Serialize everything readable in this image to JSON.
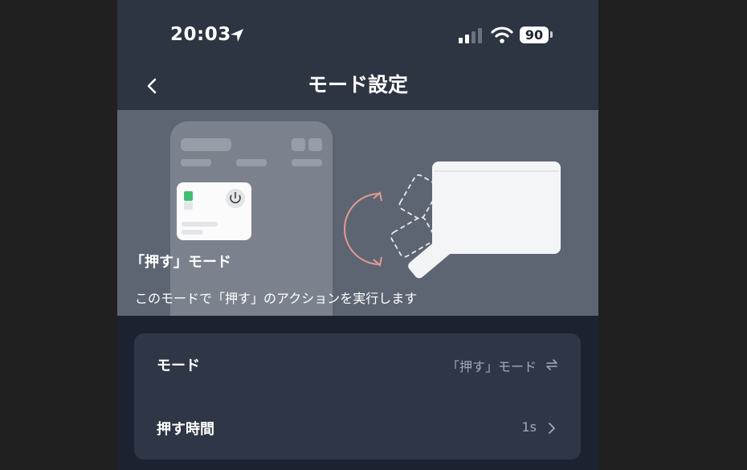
{
  "status_bar": {
    "time": "20:03",
    "battery": "90",
    "icons": [
      "location-arrow-icon",
      "cellular-signal-icon",
      "wifi-icon",
      "battery-icon"
    ]
  },
  "nav": {
    "title": "モード設定",
    "back_icon": "chevron-left-icon"
  },
  "hero": {
    "title": "「押す」モード",
    "description": "このモードで「押す」のアクションを実行します"
  },
  "settings": [
    {
      "label": "モード",
      "value": "「押す」モード",
      "icon": "swap-arrows-icon"
    },
    {
      "label": "押す時間",
      "value": "1s",
      "icon": "chevron-right-icon"
    }
  ],
  "colors": {
    "background": "#202020",
    "header": "#2d3442",
    "screen": "#1d2230",
    "hero": "#5e6572",
    "card": "#2f3645",
    "accent_green": "#3fbf73",
    "rotation_arrow": "#e39a93"
  }
}
